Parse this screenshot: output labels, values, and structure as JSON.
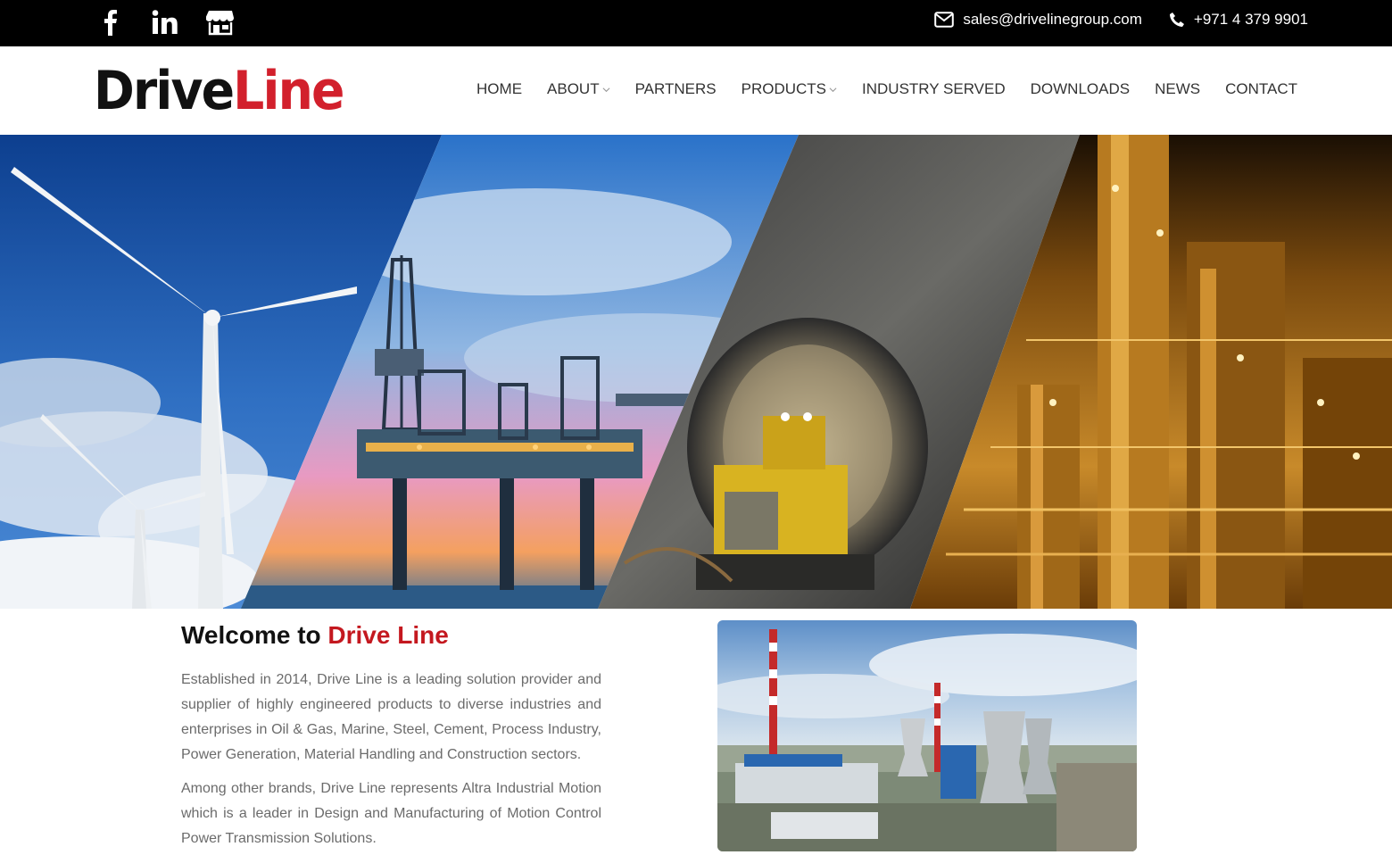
{
  "topbar": {
    "social_icons": [
      "facebook-icon",
      "linkedin-icon",
      "store-icon"
    ],
    "email": "sales@drivelinegroup.com",
    "phone": "+971 4 379 9901"
  },
  "logo": {
    "part1": "Drive",
    "part2": "Line"
  },
  "nav": {
    "items": [
      {
        "label": "HOME",
        "has_dropdown": false
      },
      {
        "label": "ABOUT",
        "has_dropdown": true
      },
      {
        "label": "PARTNERS",
        "has_dropdown": false
      },
      {
        "label": "PRODUCTS",
        "has_dropdown": true
      },
      {
        "label": "INDUSTRY SERVED",
        "has_dropdown": false
      },
      {
        "label": "DOWNLOADS",
        "has_dropdown": false
      },
      {
        "label": "NEWS",
        "has_dropdown": false
      },
      {
        "label": "CONTACT",
        "has_dropdown": false
      }
    ]
  },
  "hero": {
    "panels": [
      "wind-turbines",
      "offshore-oil-rig",
      "mining-tunnel",
      "refinery-at-night"
    ]
  },
  "welcome": {
    "title_prefix": "Welcome to ",
    "title_accent": "Drive Line",
    "paragraph1": "Established in 2014, Drive Line is a leading solution provider and supplier of highly engineered products to diverse industries and enterprises in Oil & Gas, Marine, Steel, Cement, Process Industry, Power Generation, Material Handling and Construction sectors.",
    "paragraph2": "Among other brands, Drive Line represents Altra Industrial Motion which is a leader in Design and Manufacturing of Motion Control Power Transmission Solutions."
  },
  "colors": {
    "brand_red": "#c4181f",
    "topbar_bg": "#000000",
    "nav_text": "#333333",
    "body_text": "#6b6b6b"
  }
}
